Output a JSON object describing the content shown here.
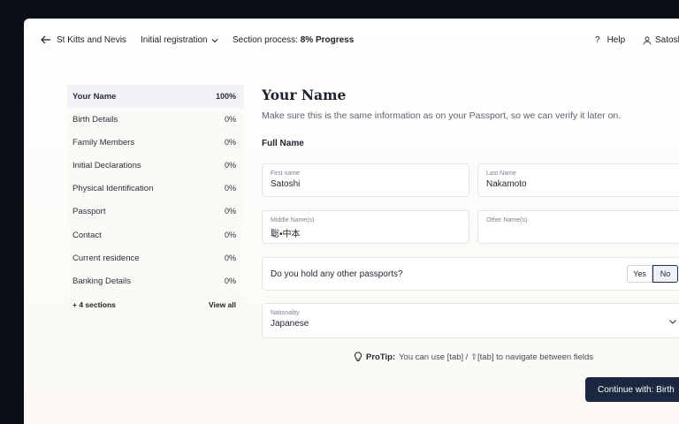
{
  "header": {
    "country": "St Kitts and Nevis",
    "registration": "Initial registration",
    "process_label": "Section process:",
    "process_value": "8% Progress",
    "help": "Help",
    "user": "Satoshi"
  },
  "sidebar": {
    "items": [
      {
        "label": "Your Name",
        "pct": "100%"
      },
      {
        "label": "Birth Details",
        "pct": "0%"
      },
      {
        "label": "Family Members",
        "pct": "0%"
      },
      {
        "label": "Initial Declarations",
        "pct": "0%"
      },
      {
        "label": "Physical Identification",
        "pct": "0%"
      },
      {
        "label": "Passport",
        "pct": "0%"
      },
      {
        "label": "Contact",
        "pct": "0%"
      },
      {
        "label": "Current residence",
        "pct": "0%"
      },
      {
        "label": "Banking Details",
        "pct": "0%"
      }
    ],
    "more": "+ 4 sections",
    "view_all": "View all"
  },
  "main": {
    "title": "Your Name",
    "subtitle": "Make sure this is the same information as on your Passport, so we can verify it later on.",
    "section": "Full Name",
    "first_name": {
      "label": "First name",
      "value": "Satoshi"
    },
    "last_name": {
      "label": "Last Name",
      "value": "Nakamoto"
    },
    "middle_name": {
      "label": "Middle Name(s)",
      "value": "聡•中本"
    },
    "other_name": {
      "label": "Other Name(s)",
      "value": ""
    },
    "question": "Do you hold any other passports?",
    "yes": "Yes",
    "no": "No",
    "nationality": {
      "label": "Nationality",
      "value": "Japanese"
    },
    "protip_bold": "ProTip:",
    "protip_text": "You can use [tab] / ⇧[tab] to navigate between fields",
    "cta": "Continue with: Birth"
  }
}
